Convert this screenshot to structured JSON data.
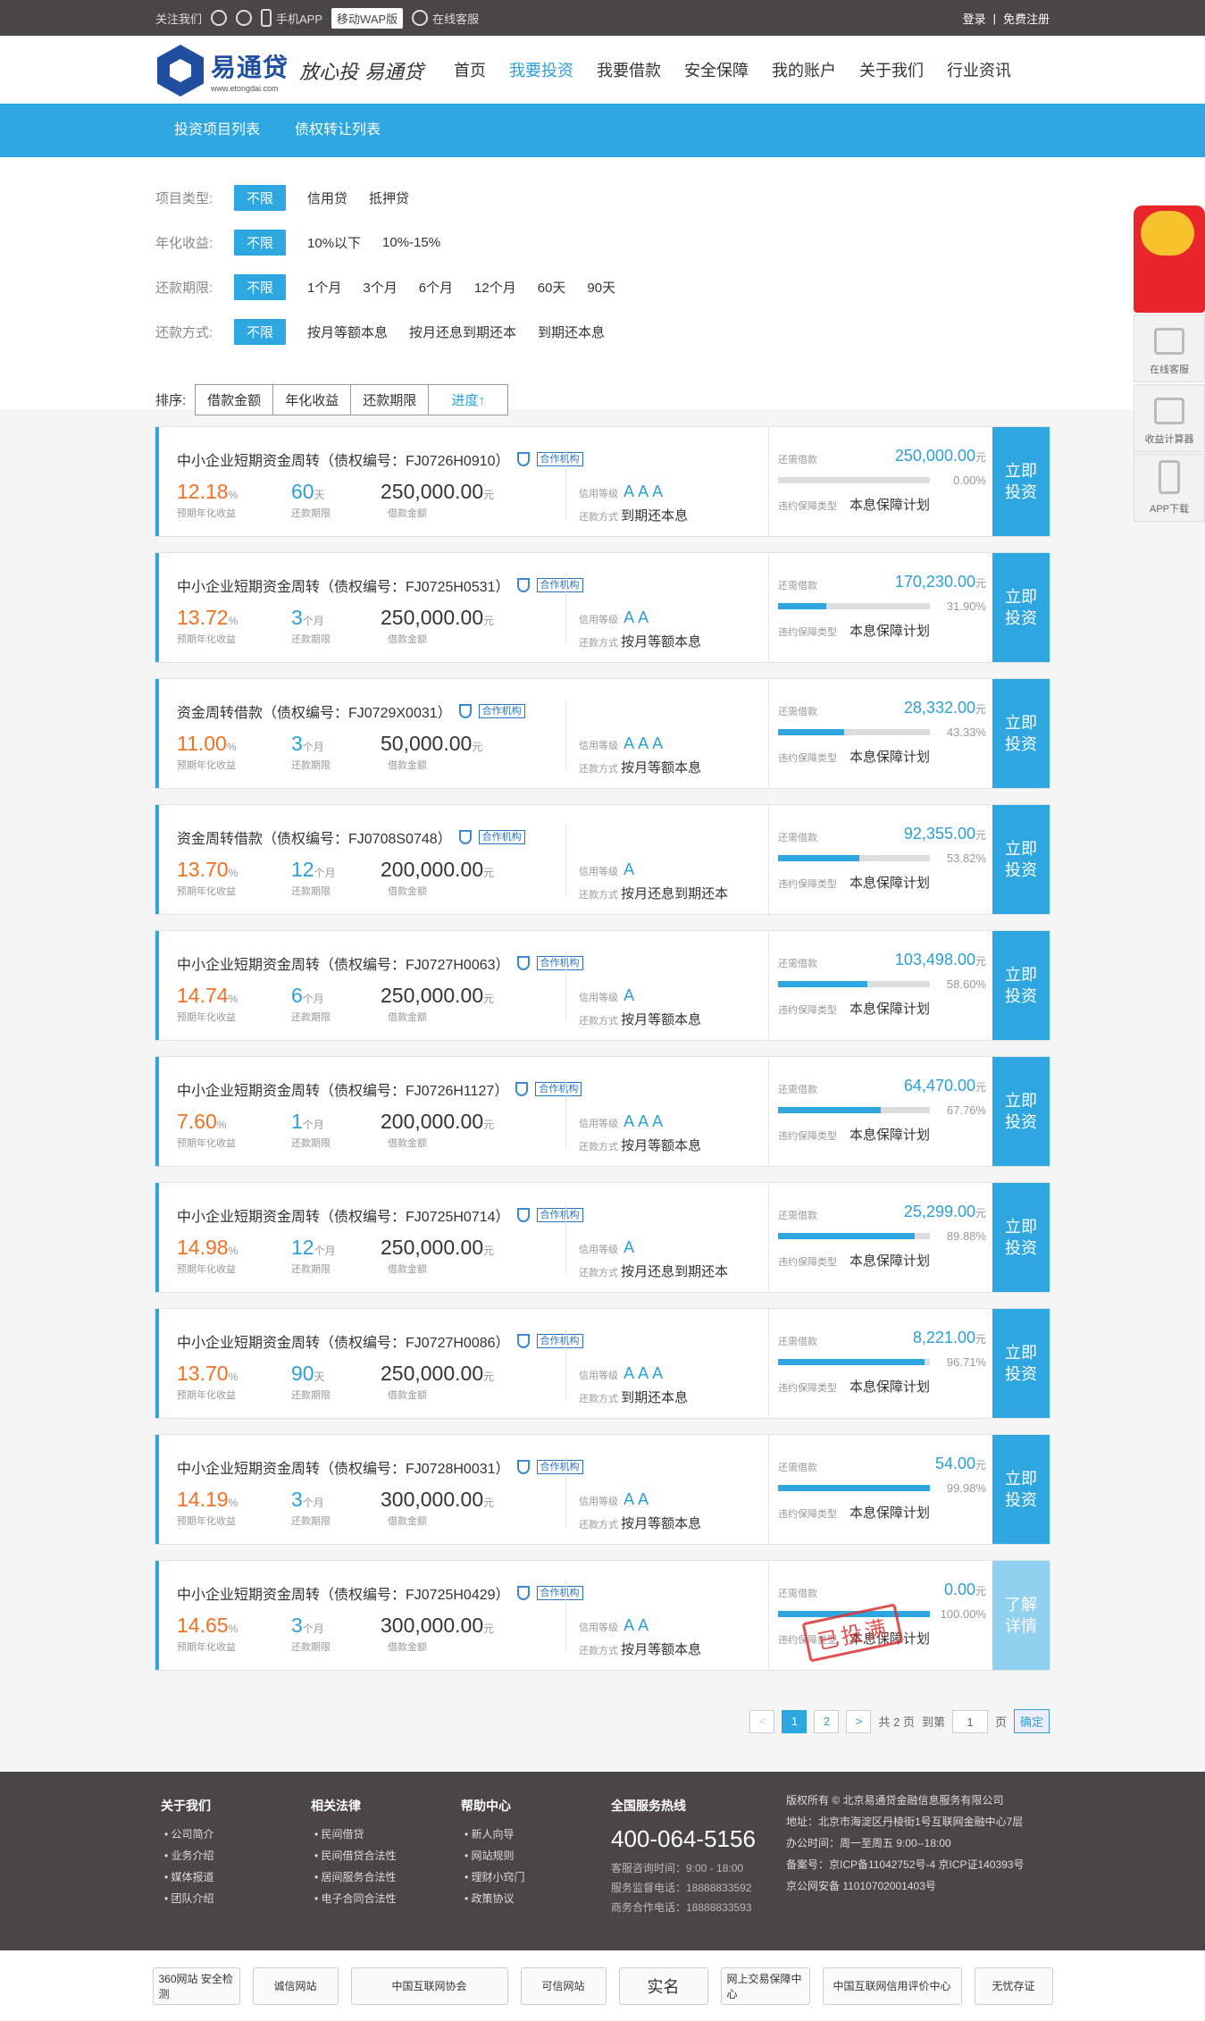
{
  "topbar": {
    "follow": "关注我们",
    "app": "手机APP",
    "wap": "移动WAP版",
    "service": "在线客服",
    "login": "登录",
    "register": "免费注册"
  },
  "logo": {
    "name": "易通贷",
    "domain": "www.etongdai.com",
    "slogan": "放心投 易通贷"
  },
  "nav": [
    "首页",
    "我要投资",
    "我要借款",
    "安全保障",
    "我的账户",
    "关于我们",
    "行业资讯"
  ],
  "subnav": [
    "投资项目列表",
    "债权转让列表"
  ],
  "filters": [
    {
      "label": "项目类型:",
      "options": [
        "不限",
        "信用贷",
        "抵押贷"
      ]
    },
    {
      "label": "年化收益:",
      "options": [
        "不限",
        "10%以下",
        "10%-15%"
      ]
    },
    {
      "label": "还款期限:",
      "options": [
        "不限",
        "1个月",
        "3个月",
        "6个月",
        "12个月",
        "60天",
        "90天"
      ]
    },
    {
      "label": "还款方式:",
      "options": [
        "不限",
        "按月等额本息",
        "按月还息到期还本",
        "到期还本息"
      ]
    }
  ],
  "sort": {
    "label": "排序:",
    "buttons": [
      "借款金额",
      "年化收益",
      "还款期限",
      "进度↑"
    ]
  },
  "labels": {
    "rate": "预期年化收益",
    "term": "还款期限",
    "amount": "借款金额",
    "credit": "信用等级",
    "method": "还款方式",
    "remain": "还需借款",
    "guarantee_label": "违约保障类型",
    "guarantee": "本息保障计划",
    "tag": "合作机构",
    "pct_unit": "%",
    "yuan": "元"
  },
  "loans": [
    {
      "title": "中小企业短期资金周转（债权编号：FJ0726H0910）",
      "rate": "12.18",
      "term": "60",
      "term_unit": "天",
      "amount": "250,000.00",
      "credit": "AAA",
      "method": "到期还本息",
      "remain": "250,000.00",
      "progress": "0.00%",
      "progress_value": 0.0,
      "action": "立即投资",
      "full": false
    },
    {
      "title": "中小企业短期资金周转（债权编号：FJ0725H0531）",
      "rate": "13.72",
      "term": "3",
      "term_unit": "个月",
      "amount": "250,000.00",
      "credit": "AA",
      "method": "按月等额本息",
      "remain": "170,230.00",
      "progress": "31.90%",
      "progress_value": 31.9,
      "action": "立即投资",
      "full": false
    },
    {
      "title": "资金周转借款（债权编号：FJ0729X0031）",
      "rate": "11.00",
      "term": "3",
      "term_unit": "个月",
      "amount": "50,000.00",
      "credit": "AAA",
      "method": "按月等额本息",
      "remain": "28,332.00",
      "progress": "43.33%",
      "progress_value": 43.33,
      "action": "立即投资",
      "full": false
    },
    {
      "title": "资金周转借款（债权编号：FJ0708S0748）",
      "rate": "13.70",
      "term": "12",
      "term_unit": "个月",
      "amount": "200,000.00",
      "credit": "A",
      "method": "按月还息到期还本",
      "remain": "92,355.00",
      "progress": "53.82%",
      "progress_value": 53.82,
      "action": "立即投资",
      "full": false
    },
    {
      "title": "中小企业短期资金周转（债权编号：FJ0727H0063）",
      "rate": "14.74",
      "term": "6",
      "term_unit": "个月",
      "amount": "250,000.00",
      "credit": "A",
      "method": "按月等额本息",
      "remain": "103,498.00",
      "progress": "58.60%",
      "progress_value": 58.6,
      "action": "立即投资",
      "full": false
    },
    {
      "title": "中小企业短期资金周转（债权编号：FJ0726H1127）",
      "rate": "7.60",
      "term": "1",
      "term_unit": "个月",
      "amount": "200,000.00",
      "credit": "AAA",
      "method": "按月等额本息",
      "remain": "64,470.00",
      "progress": "67.76%",
      "progress_value": 67.76,
      "action": "立即投资",
      "full": false
    },
    {
      "title": "中小企业短期资金周转（债权编号：FJ0725H0714）",
      "rate": "14.98",
      "term": "12",
      "term_unit": "个月",
      "amount": "250,000.00",
      "credit": "A",
      "method": "按月还息到期还本",
      "remain": "25,299.00",
      "progress": "89.88%",
      "progress_value": 89.88,
      "action": "立即投资",
      "full": false
    },
    {
      "title": "中小企业短期资金周转（债权编号：FJ0727H0086）",
      "rate": "13.70",
      "term": "90",
      "term_unit": "天",
      "amount": "250,000.00",
      "credit": "AAA",
      "method": "到期还本息",
      "remain": "8,221.00",
      "progress": "96.71%",
      "progress_value": 96.71,
      "action": "立即投资",
      "full": false
    },
    {
      "title": "中小企业短期资金周转（债权编号：FJ0728H0031）",
      "rate": "14.19",
      "term": "3",
      "term_unit": "个月",
      "amount": "300,000.00",
      "credit": "AA",
      "method": "按月等额本息",
      "remain": "54.00",
      "progress": "99.98%",
      "progress_value": 99.98,
      "action": "立即投资",
      "full": false
    },
    {
      "title": "中小企业短期资金周转（债权编号：FJ0725H0429）",
      "rate": "14.65",
      "term": "3",
      "term_unit": "个月",
      "amount": "300,000.00",
      "credit": "AA",
      "method": "按月等额本息",
      "remain": "0.00",
      "progress": "100.00%",
      "progress_value": 100.0,
      "action": "了解详情",
      "full": true,
      "stamp": "已投满"
    }
  ],
  "pager": {
    "prev": "<",
    "pages": [
      "1",
      "2"
    ],
    "next": ">",
    "total": "共 2 页",
    "goto": "到第",
    "page_input": "1",
    "page_unit": "页",
    "confirm": "确定"
  },
  "side": {
    "service": "在线客服",
    "calc": "收益计算器",
    "app": "APP下载"
  },
  "footer": {
    "cols": [
      {
        "title": "关于我们",
        "items": [
          "公司简介",
          "业务介绍",
          "媒体报道",
          "团队介绍"
        ]
      },
      {
        "title": "相关法律",
        "items": [
          "民间借贷",
          "民间借贷合法性",
          "居间服务合法性",
          "电子合同合法性"
        ]
      },
      {
        "title": "帮助中心",
        "items": [
          "新人向导",
          "网站规则",
          "理财小窍门",
          "政策协议"
        ]
      }
    ],
    "hotline_title": "全国服务热线",
    "phone": "400-064-5156",
    "hours": "客服咨询时间：9:00 - 18:00",
    "supervise": "服务监督电话：18888833592",
    "business": "商务合作电话：18888833593",
    "copyright": [
      "版权所有 © 北京易通贷金融信息服务有限公司",
      "地址：北京市海淀区丹棱街1号互联网金融中心7层",
      "办公时间：周一至周五 9:00--18:00",
      "备案号：京ICP备11042752号-4    京ICP证140393号",
      "京公网安备 11010702001403号"
    ]
  },
  "badges": [
    "360网站 安全检测",
    "诚信网站",
    "中国互联网协会",
    "可信网站",
    "实名",
    "网上交易保障中心",
    "中国互联网信用评价中心",
    "无忧存证"
  ]
}
